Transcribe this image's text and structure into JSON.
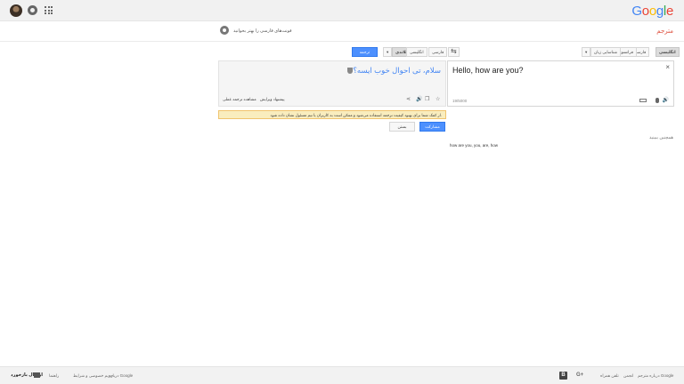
{
  "logo": {
    "letters": [
      "G",
      "o",
      "o",
      "g",
      "l",
      "e"
    ]
  },
  "header": {
    "app_title": "مترجم"
  },
  "notice": {
    "text": "فونت‌های فارسی را بهتر بخوانید"
  },
  "source_langs": [
    {
      "label": "انگلیسی",
      "active": true
    },
    {
      "label": "فارسی",
      "active": false
    },
    {
      "label": "فرانسوی",
      "active": false
    },
    {
      "label": "شناسایی زبان",
      "active": false
    },
    {
      "label": "▾",
      "active": false
    }
  ],
  "target_langs": [
    {
      "label": "فارسی",
      "active": false
    },
    {
      "label": "▾",
      "active": false
    },
    {
      "label": "فنلاندی",
      "active": true
    },
    {
      "label": "انگلیسی",
      "active": false
    }
  ],
  "buttons": {
    "translate": "ترجمه",
    "share": "مشارکت",
    "close": "بستن",
    "swap_icon": "swap-icon"
  },
  "source": {
    "text": "Hello, how are you?",
    "clear": "×",
    "char_count": "19/5000"
  },
  "target": {
    "text": "سلام، تی احوال خوب ایسه؟",
    "edit_suggest": "پیشنهاد ویرایش",
    "view_translation": "مشاهده ترجمه عملی"
  },
  "yellow_bar": {
    "text": "از کمک شما برای بهبود کیفیت ترجمه استفاده می‌شود و ممکن است به کاربران یا تیم مسئول نشان داده شود."
  },
  "see_also": "همچنین ببینید",
  "alternatives": "how are you, you, are, how",
  "footer": {
    "feedback": "ارسال بازخورد",
    "links_left": [
      "درباره Google",
      "حریم خصوصی و شرایط",
      "راهنما"
    ],
    "links_right": [
      "درباره مترجم Google",
      "انجمن",
      "تلفن همراه"
    ],
    "blogger": "B",
    "gplus": "G+"
  }
}
